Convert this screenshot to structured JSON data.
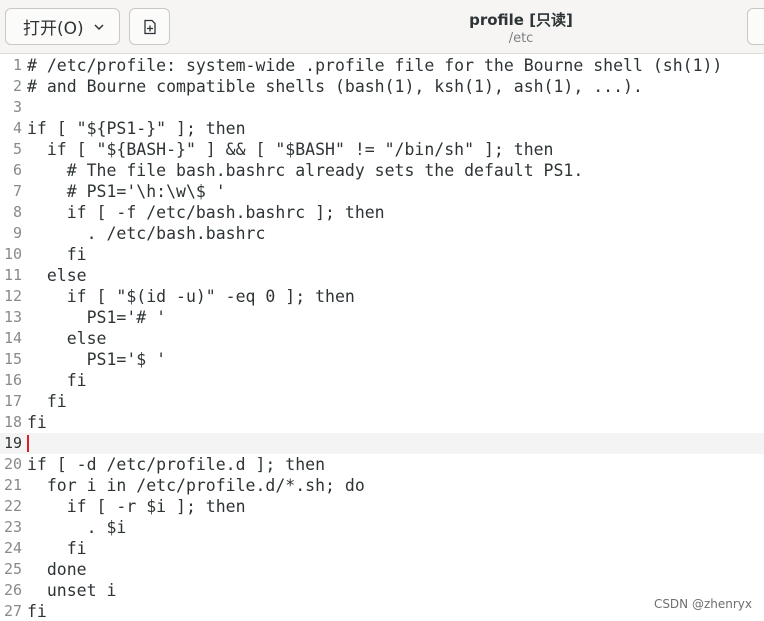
{
  "header": {
    "open_label": "打开(O)",
    "open_caret_icon": "chevron-down-icon",
    "new_tab_icon": "new-document-icon",
    "title": "profile [只读]",
    "subtitle": "/etc"
  },
  "editor": {
    "current_line": 19,
    "lines": [
      {
        "num": "1",
        "text": "# /etc/profile: system-wide .profile file for the Bourne shell (sh(1))"
      },
      {
        "num": "2",
        "text": "# and Bourne compatible shells (bash(1), ksh(1), ash(1), ...)."
      },
      {
        "num": "3",
        "text": ""
      },
      {
        "num": "4",
        "text": "if [ \"${PS1-}\" ]; then"
      },
      {
        "num": "5",
        "text": "  if [ \"${BASH-}\" ] && [ \"$BASH\" != \"/bin/sh\" ]; then"
      },
      {
        "num": "6",
        "text": "    # The file bash.bashrc already sets the default PS1."
      },
      {
        "num": "7",
        "text": "    # PS1='\\h:\\w\\$ '"
      },
      {
        "num": "8",
        "text": "    if [ -f /etc/bash.bashrc ]; then"
      },
      {
        "num": "9",
        "text": "      . /etc/bash.bashrc"
      },
      {
        "num": "10",
        "text": "    fi"
      },
      {
        "num": "11",
        "text": "  else"
      },
      {
        "num": "12",
        "text": "    if [ \"$(id -u)\" -eq 0 ]; then"
      },
      {
        "num": "13",
        "text": "      PS1='# '"
      },
      {
        "num": "14",
        "text": "    else"
      },
      {
        "num": "15",
        "text": "      PS1='$ '"
      },
      {
        "num": "16",
        "text": "    fi"
      },
      {
        "num": "17",
        "text": "  fi"
      },
      {
        "num": "18",
        "text": "fi"
      },
      {
        "num": "19",
        "text": ""
      },
      {
        "num": "20",
        "text": "if [ -d /etc/profile.d ]; then"
      },
      {
        "num": "21",
        "text": "  for i in /etc/profile.d/*.sh; do"
      },
      {
        "num": "22",
        "text": "    if [ -r $i ]; then"
      },
      {
        "num": "23",
        "text": "      . $i"
      },
      {
        "num": "24",
        "text": "    fi"
      },
      {
        "num": "25",
        "text": "  done"
      },
      {
        "num": "26",
        "text": "  unset i"
      },
      {
        "num": "27",
        "text": "fi"
      }
    ]
  },
  "watermark": "CSDN @zhenryx"
}
